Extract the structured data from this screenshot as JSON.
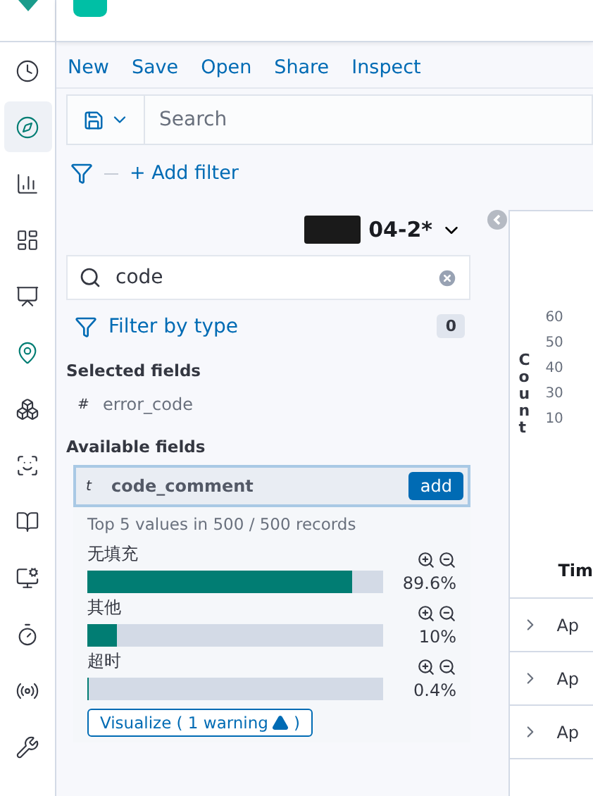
{
  "nav_rail": {
    "items": [
      {
        "selected": false
      },
      {
        "selected": true
      },
      {
        "selected": false
      },
      {
        "selected": false
      },
      {
        "selected": false
      },
      {
        "selected": false
      },
      {
        "selected": false
      },
      {
        "selected": false
      },
      {
        "selected": false
      },
      {
        "selected": false
      },
      {
        "selected": false
      },
      {
        "selected": false
      },
      {
        "selected": false
      }
    ]
  },
  "top_menu": [
    "New",
    "Save",
    "Open",
    "Share",
    "Inspect"
  ],
  "search": {
    "placeholder": "Search"
  },
  "add_filter": "+ Add filter",
  "index_pattern": "04-2*",
  "field_search": {
    "value": "code"
  },
  "filter_by_type": {
    "label": "Filter by type",
    "count": "0"
  },
  "selected_fields": {
    "heading": "Selected fields",
    "fields": [
      {
        "type": "#",
        "name": "error_code"
      }
    ]
  },
  "available_fields": {
    "heading": "Available fields",
    "fields": [
      {
        "type": "t",
        "name": "code_comment",
        "action": "add",
        "expanded": true
      }
    ]
  },
  "details": {
    "summary": "Top 5 values in 500 / 500 records",
    "values": [
      {
        "label": "无填充",
        "level": 0.896,
        "reading": "89.6%"
      },
      {
        "label": "其他",
        "level": 0.1,
        "reading": "10%"
      },
      {
        "label": "超时",
        "level": 0.004,
        "reading": "0.4%"
      }
    ],
    "button": {
      "label": "Visualize ( 1 warning",
      "suffix": ")"
    }
  },
  "chart": {
    "ylabel": "Count",
    "ticks": [
      "60",
      "50",
      "40",
      "30",
      "10"
    ]
  },
  "table": {
    "header": "Tim",
    "rows": [
      "Ap",
      "Ap",
      "Ap"
    ]
  }
}
